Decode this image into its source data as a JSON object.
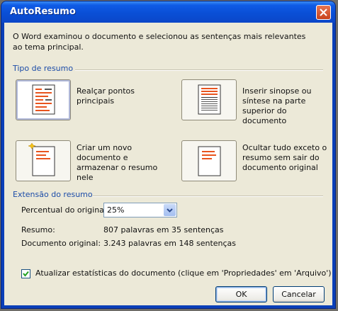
{
  "window": {
    "title": "AutoResumo"
  },
  "intro": "O Word examinou o documento e selecionou as sentenças mais relevantes ao tema principal.",
  "summary_type": {
    "group_label": "Tipo de resumo",
    "options": [
      {
        "label": "Realçar pontos principais",
        "selected": true
      },
      {
        "label": "Inserir sinopse ou síntese na parte superior do documento",
        "selected": false
      },
      {
        "label": "Criar um novo documento e armazenar o resumo nele",
        "selected": false
      },
      {
        "label": "Ocultar tudo exceto o resumo sem sair do documento original",
        "selected": false
      }
    ]
  },
  "summary_length": {
    "group_label": "Extensão do resumo",
    "percent_label": "Percentual do original:",
    "percent_value": "25%",
    "resumo_label": "Resumo:",
    "resumo_value": "807 palavras em 35 sentenças",
    "documento_label": "Documento original:",
    "documento_value": "3.243 palavras em 148 sentenças"
  },
  "update_stats": {
    "checked": true,
    "label": "Atualizar estatísticas do documento (clique em 'Propriedades' em 'Arquivo')"
  },
  "buttons": {
    "ok": "OK",
    "cancel": "Cancelar"
  },
  "colors": {
    "title_bar": "#0a4fd6",
    "highlight": "#e8541e",
    "close": "#c8421c"
  },
  "icons": [
    "close-icon",
    "highlight-doc-icon",
    "summary-top-doc-icon",
    "new-doc-icon",
    "hide-doc-icon",
    "dropdown-arrow-icon",
    "check-icon"
  ]
}
